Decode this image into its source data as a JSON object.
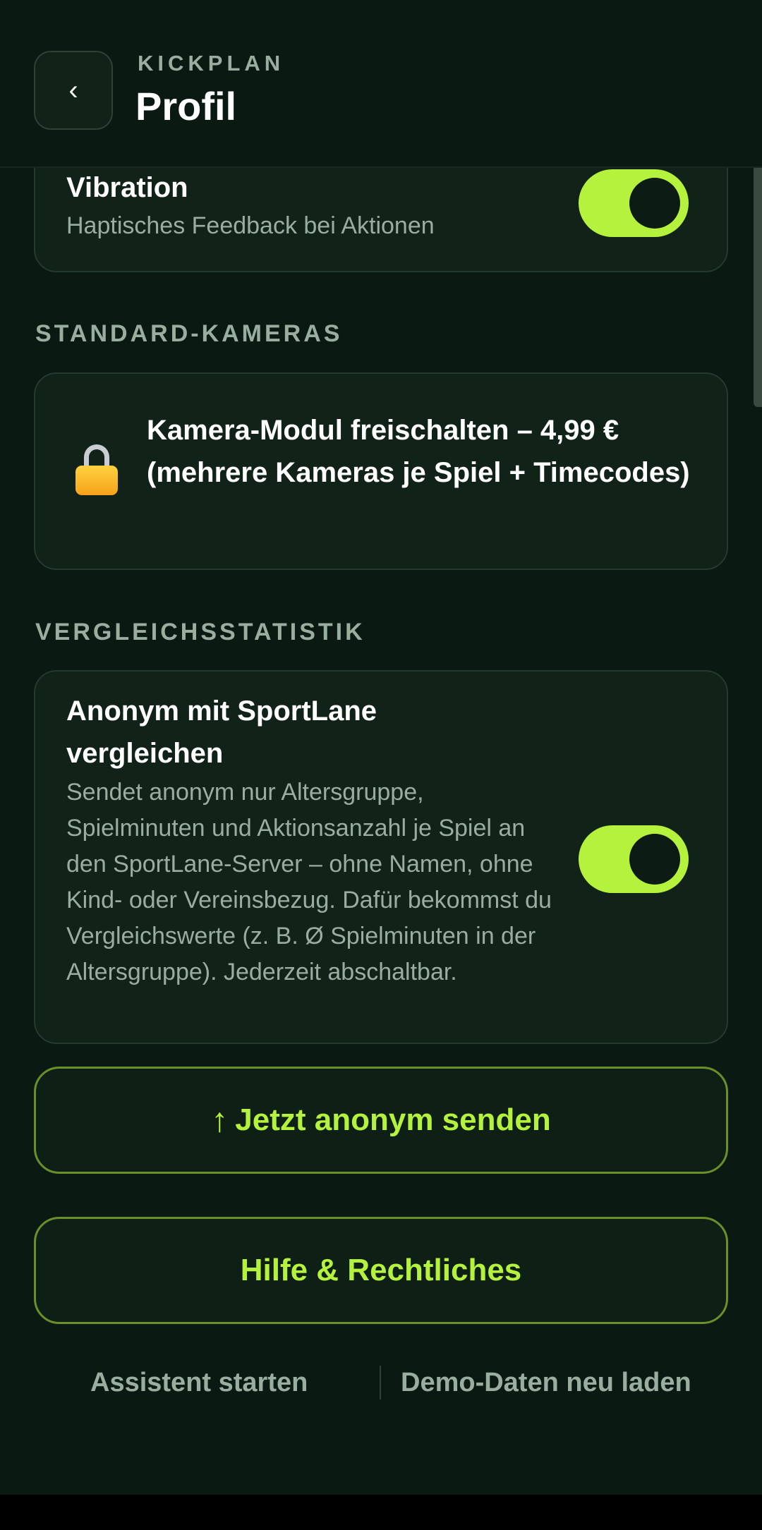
{
  "header": {
    "back_icon": "‹",
    "brand": "KICKPLAN",
    "title": "Profil"
  },
  "vibration": {
    "title": "Vibration",
    "description": "Haptisches Feedback bei Aktionen",
    "enabled": true
  },
  "sections": {
    "cameras_label": "STANDARD-KAMERAS",
    "comparison_label": "VERGLEICHSSTATISTIK"
  },
  "camera_unlock": {
    "icon": "lock-icon",
    "text": "Kamera-Modul freischalten – 4,99 € (mehrere Kameras je Spiel + Timecodes)"
  },
  "comparison": {
    "title": "Anonym mit SportLane vergleichen",
    "description": "Sendet anonym nur Altersgruppe, Spielminuten und Aktionsanzahl je Spiel an den SportLane-Server – ohne Namen, ohne Kind- oder Vereinsbezug. Dafür bekommst du Vergleichswerte (z. B. Ø Spielminuten in der Altersgruppe). Jederzeit abschaltbar.",
    "enabled": true
  },
  "buttons": {
    "send_arrow": "↑",
    "send_label": "Jetzt anonym senden",
    "help_label": "Hilfe & Rechtliches"
  },
  "footer_links": {
    "assistant": "Assistent starten",
    "demo": "Demo-Daten neu laden"
  },
  "colors": {
    "background": "#0a1a13",
    "accent": "#b5f23d",
    "muted_text": "#9aae9f"
  }
}
